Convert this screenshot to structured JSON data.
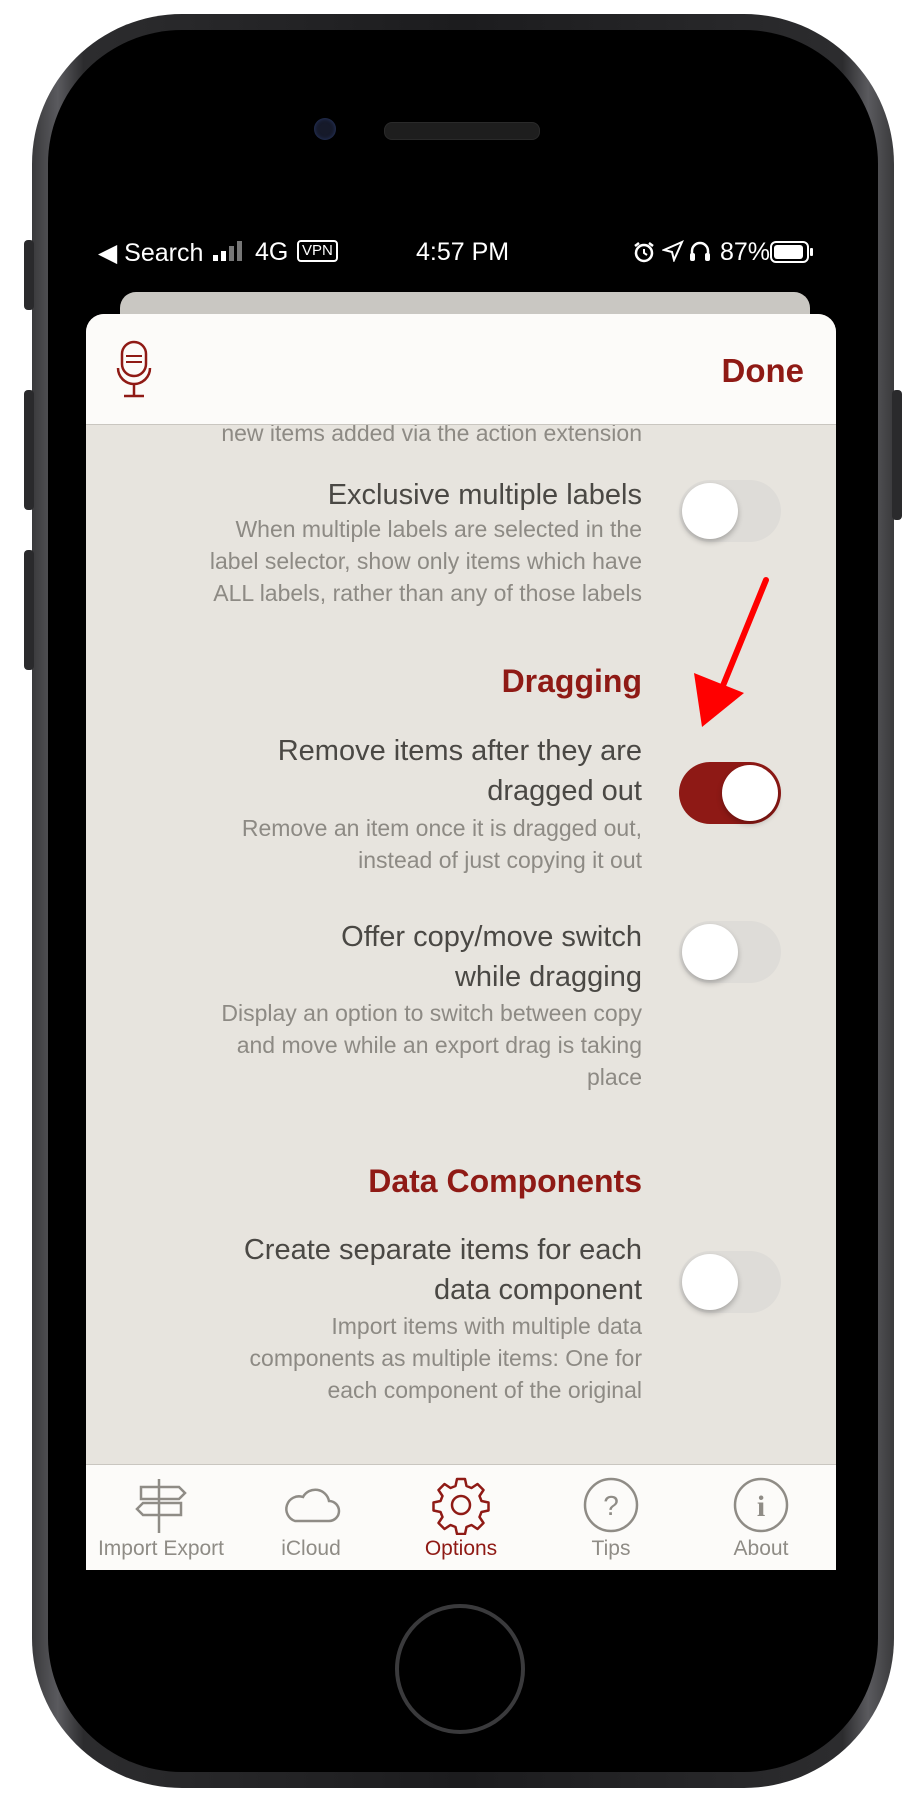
{
  "status_bar": {
    "back_label": "◀ Search",
    "network": "4G",
    "vpn": "VPN",
    "time": "4:57 PM",
    "battery": "87%"
  },
  "nav": {
    "done_label": "Done",
    "mic_icon": "microphone-icon"
  },
  "settings": {
    "cut_off_text": "new items added via the action extension",
    "exclusive_labels": {
      "title": "Exclusive multiple labels",
      "desc_1": "When multiple labels are selected in the",
      "desc_2": "label selector, show only items which have",
      "desc_3": "ALL labels, rather than any of those labels",
      "enabled": false
    },
    "dragging_header": "Dragging",
    "remove_after_drag": {
      "title_1": "Remove items after they are",
      "title_2": "dragged out",
      "desc_1": "Remove an item once it is dragged out,",
      "desc_2": "instead of just copying it out",
      "enabled": true
    },
    "copy_move_switch": {
      "title_1": "Offer copy/move switch",
      "title_2": "while dragging",
      "desc_1": "Display an option to switch between copy",
      "desc_2": "and move while an export drag is taking",
      "desc_3": "place",
      "enabled": false
    },
    "data_components_header": "Data Components",
    "separate_items": {
      "title_1": "Create separate items for each",
      "title_2": "data component",
      "desc_1": "Import items with multiple data",
      "desc_2": "components as multiple items: One for",
      "desc_3": "each component of the original",
      "enabled": false
    }
  },
  "tabs": [
    {
      "label": "Import Export",
      "icon": "signpost-icon",
      "active": false
    },
    {
      "label": "iCloud",
      "icon": "cloud-icon",
      "active": false
    },
    {
      "label": "Options",
      "icon": "gear-icon",
      "active": true
    },
    {
      "label": "Tips",
      "icon": "question-icon",
      "active": false
    },
    {
      "label": "About",
      "icon": "info-icon",
      "active": false
    }
  ],
  "colors": {
    "accent": "#8f1a15",
    "sheet_bg": "#e7e4de",
    "arrow": "#ff0000"
  }
}
